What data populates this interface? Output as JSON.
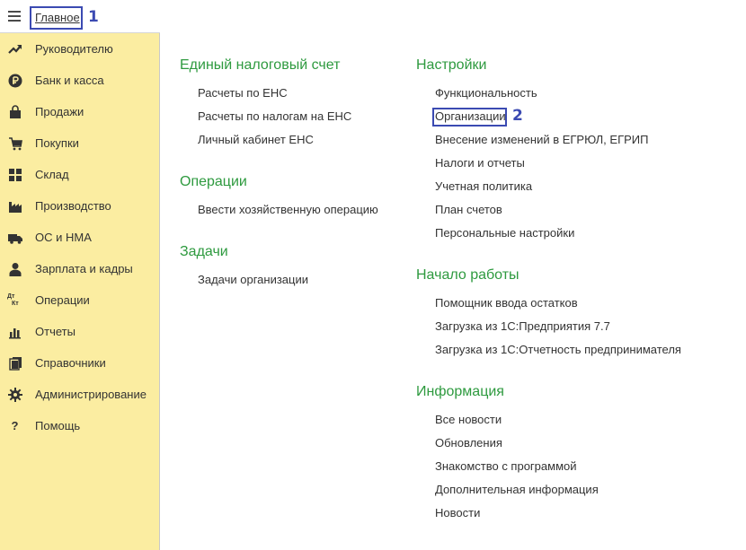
{
  "header": {
    "home_label": "Главное",
    "badge_1": "1",
    "badge_2": "2"
  },
  "sidebar": {
    "items": [
      {
        "label": "Руководителю",
        "icon": "trend-up-icon"
      },
      {
        "label": "Банк и касса",
        "icon": "ruble-icon"
      },
      {
        "label": "Продажи",
        "icon": "shopping-bag-icon"
      },
      {
        "label": "Покупки",
        "icon": "cart-icon"
      },
      {
        "label": "Склад",
        "icon": "warehouse-grid-icon"
      },
      {
        "label": "Производство",
        "icon": "factory-icon"
      },
      {
        "label": "ОС и НМА",
        "icon": "truck-icon"
      },
      {
        "label": "Зарплата и кадры",
        "icon": "person-icon"
      },
      {
        "label": "Операции",
        "icon": "dt-kt-icon",
        "glyph_top": "Дт",
        "glyph_bottom": "Кт"
      },
      {
        "label": "Отчеты",
        "icon": "bar-chart-icon"
      },
      {
        "label": "Справочники",
        "icon": "books-icon"
      },
      {
        "label": "Администрирование",
        "icon": "gear-icon"
      },
      {
        "label": "Помощь",
        "icon": "question-icon",
        "glyph": "?"
      }
    ]
  },
  "sections": {
    "ens": {
      "title": "Единый налоговый счет",
      "links": [
        "Расчеты по ЕНС",
        "Расчеты по налогам на ЕНС",
        "Личный кабинет ЕНС"
      ]
    },
    "operations": {
      "title": "Операции",
      "links": [
        "Ввести хозяйственную операцию"
      ]
    },
    "tasks": {
      "title": "Задачи",
      "links": [
        "Задачи организации"
      ]
    },
    "settings": {
      "title": "Настройки",
      "links": [
        "Функциональность",
        "Организации",
        "Внесение изменений в ЕГРЮЛ, ЕГРИП",
        "Налоги и отчеты",
        "Учетная политика",
        "План счетов",
        "Персональные настройки"
      ]
    },
    "start": {
      "title": "Начало работы",
      "links": [
        "Помощник ввода остатков",
        "Загрузка из 1С:Предприятия 7.7",
        "Загрузка из 1С:Отчетность предпринимателя"
      ]
    },
    "info": {
      "title": "Информация",
      "links": [
        "Все новости",
        "Обновления",
        "Знакомство с программой",
        "Дополнительная информация",
        "Новости"
      ]
    }
  },
  "colors": {
    "sidebar_bg": "#fbeda1",
    "section_title": "#2e9a3f",
    "highlight": "#3b4ab2"
  }
}
